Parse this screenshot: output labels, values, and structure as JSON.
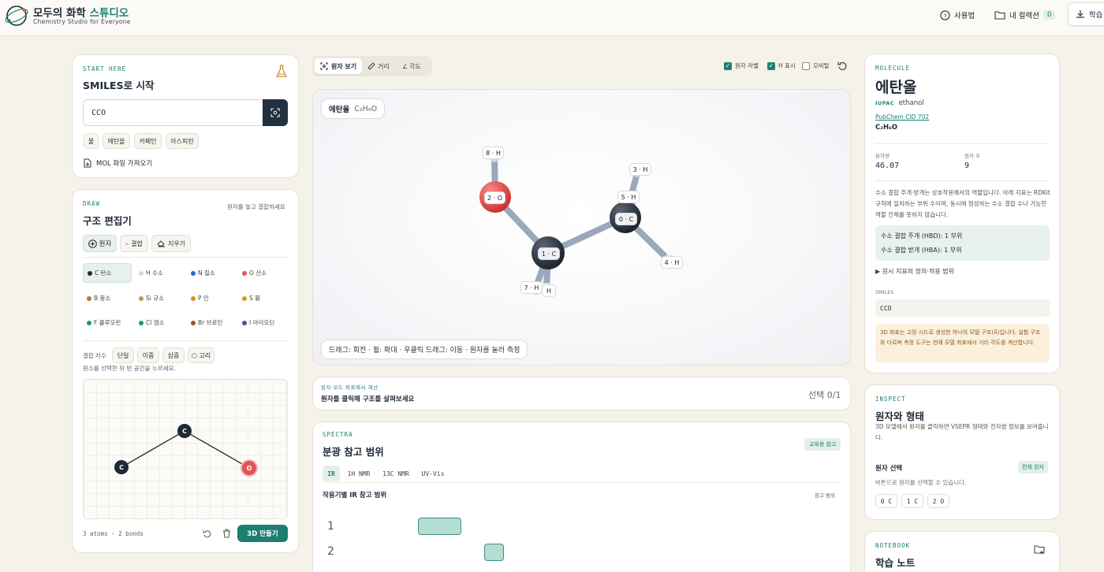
{
  "header": {
    "brand_main": "모두의 화학",
    "brand_accent": "스튜디오",
    "brand_sub": "Chemistry Studio for Everyone",
    "help": "사용법",
    "collection": "내 컬렉션",
    "collection_count": "0",
    "study": "학습"
  },
  "smiles_card": {
    "kicker": "START HERE",
    "title": "SMILES로 시작",
    "input_value": "CCO",
    "examples": [
      "물",
      "에탄올",
      "카페인",
      "아스피린"
    ],
    "mol_import": "MOL 파일 가져오기"
  },
  "draw_card": {
    "kicker": "DRAW",
    "title": "구조 편집기",
    "hint": "원자를 놓고 결합하세요",
    "tools": [
      "원자",
      "결합",
      "지우기"
    ],
    "elements": [
      {
        "label": "C 탄소",
        "color": "#1f2937"
      },
      {
        "label": "H 수소",
        "color": "#d7dbe0"
      },
      {
        "label": "N 질소",
        "color": "#2563eb"
      },
      {
        "label": "O 산소",
        "color": "#e25555"
      },
      {
        "label": "B 붕소",
        "color": "#b7791f"
      },
      {
        "label": "Si 규소",
        "color": "#b89a55"
      },
      {
        "label": "P 인",
        "color": "#ea8a1e"
      },
      {
        "label": "S 황",
        "color": "#d4a017"
      },
      {
        "label": "F 플루오린",
        "color": "#1d9a6c"
      },
      {
        "label": "Cl 염소",
        "color": "#1d9a6c"
      },
      {
        "label": "Br 브로민",
        "color": "#a0522d"
      },
      {
        "label": "I 아이오딘",
        "color": "#6b3fa0"
      }
    ],
    "bond_order_label": "결합 차수",
    "bond_orders": [
      "단일",
      "이중",
      "삼중",
      "고리"
    ],
    "select_hint": "원소를 선택한 뒤 빈 공간을 누르세요.",
    "canvas_atoms": [
      "C",
      "C",
      "O"
    ],
    "stats": "3 atoms · 2 bonds",
    "make3d": "3D 만들기"
  },
  "viewer": {
    "tabs": [
      "원자 보기",
      "거리",
      "각도"
    ],
    "toggles": [
      {
        "label": "원자 라벨",
        "checked": true
      },
      {
        "label": "H 표시",
        "checked": true
      },
      {
        "label": "오비탈",
        "checked": false
      }
    ],
    "mol_name": "에탄올",
    "formula": "C₂H₆O",
    "atom_labels": [
      "8 · H",
      "2 · O",
      "3 · H",
      "5 · H",
      "0 · C",
      "1 · C",
      "4 · H",
      "7 · H",
      "H"
    ],
    "hint": "드래그: 회전 · 휠: 확대 · 우클릭 드래그: 이동 · 원자를 눌러 측정"
  },
  "measure": {
    "kicker": "원자 모드 좌표에서 계산",
    "title": "원자를 클릭해 구조를 살펴보세요",
    "selection": "선택 0/1"
  },
  "spectra": {
    "kicker": "SPECTRA",
    "title": "분광 참고 범위",
    "badge": "교육용 참고",
    "tabs": [
      "IR",
      "1H NMR",
      "13C NMR",
      "UV-Vis"
    ],
    "subtitle": "작용기별 IR 참고 범위",
    "ref": "참고 범위",
    "rows": [
      "1",
      "2"
    ]
  },
  "molecule": {
    "kicker": "MOLECULE",
    "name": "에탄올",
    "iupac_label": "IUPAC",
    "iupac": "ethanol",
    "pubchem": "PubChem CID 702",
    "formula": "C₂H₆O",
    "mw_label": "분자량",
    "mw": "46.07",
    "atoms_label": "원자 수",
    "atoms": "9",
    "hbond_desc": "수소 결합 주개·받개는 상호작용에서의 역할입니다. 아래 지표는 RDKit 규칙에 일치하는 부위 수이며, 동시에 형성하는 수소 결합 수나 가능한 역할 전체를 뜻하지 않습니다.",
    "hbd": "수소 결합 주개 (HBD): 1 부위",
    "hba": "수소 결합 받개 (HBA): 1 부위",
    "disclosure": "원시 지표의 정의·적용 범위",
    "smiles_label": "SMILES",
    "smiles": "CCO",
    "note": "3D 좌표는 고정 시드로 생성한 하나의 모델 구조(Å)입니다. 실험 구조와 다르며 측정 도구는 현재 모델 좌표에서 거리·각도를 계산합니다."
  },
  "inspect": {
    "kicker": "INSPECT",
    "title": "원자와 형태",
    "desc": "3D 모델에서 원자를 클릭하면 VSEPR 형태와 전자쌍 정보를 보여줍니다.",
    "select_title": "원자 선택",
    "all_atoms": "전체 원자",
    "select_hint": "버튼으로 원자를 선택할 수 있습니다.",
    "atom_buttons": [
      "0 C",
      "1 C",
      "2 O"
    ]
  },
  "notebook": {
    "kicker": "NOTEBOOK",
    "title": "학습 노트"
  },
  "colors": {
    "accent": "#1d7f74",
    "dark": "#22313f",
    "oxygen": "#e25555"
  }
}
